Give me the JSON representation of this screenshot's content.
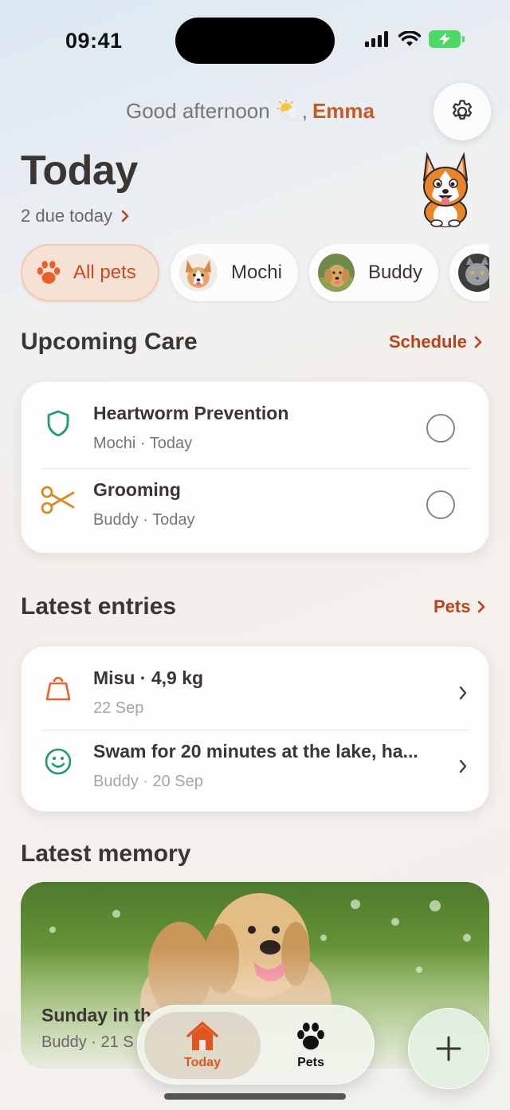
{
  "status": {
    "time": "09:41"
  },
  "header": {
    "greeting": "Good afternoon",
    "greeting_comma": ",",
    "user_name": "Emma",
    "title": "Today",
    "due_text": "2 due today"
  },
  "filters": [
    {
      "label": "All pets",
      "active": true
    },
    {
      "label": "Mochi",
      "active": false
    },
    {
      "label": "Buddy",
      "active": false
    },
    {
      "label": "",
      "active": false
    }
  ],
  "upcoming": {
    "title": "Upcoming Care",
    "link": "Schedule",
    "items": [
      {
        "title": "Heartworm Prevention",
        "meta": "Mochi · Today",
        "icon": "shield-icon",
        "color": "#1e9a6e"
      },
      {
        "title": "Grooming",
        "meta": "Buddy · Today",
        "icon": "scissors-icon",
        "color": "#d88b1e"
      }
    ]
  },
  "entries": {
    "title": "Latest entries",
    "link": "Pets",
    "items": [
      {
        "title": "Misu · 4,9 kg",
        "meta": "22 Sep",
        "icon": "weight-icon",
        "color": "#e8612a"
      },
      {
        "title": "Swam for 20 minutes at the lake, ha...",
        "meta": "Buddy · 20 Sep",
        "icon": "smile-icon",
        "color": "#1e9a6e"
      }
    ]
  },
  "memory": {
    "title": "Latest memory",
    "caption": "Sunday in th",
    "meta": "Buddy · 21 S"
  },
  "tabbar": {
    "today": "Today",
    "pets": "Pets"
  },
  "colors": {
    "accent": "#c65b2a",
    "link": "#b9431b",
    "tab_active": "#e0541e"
  }
}
